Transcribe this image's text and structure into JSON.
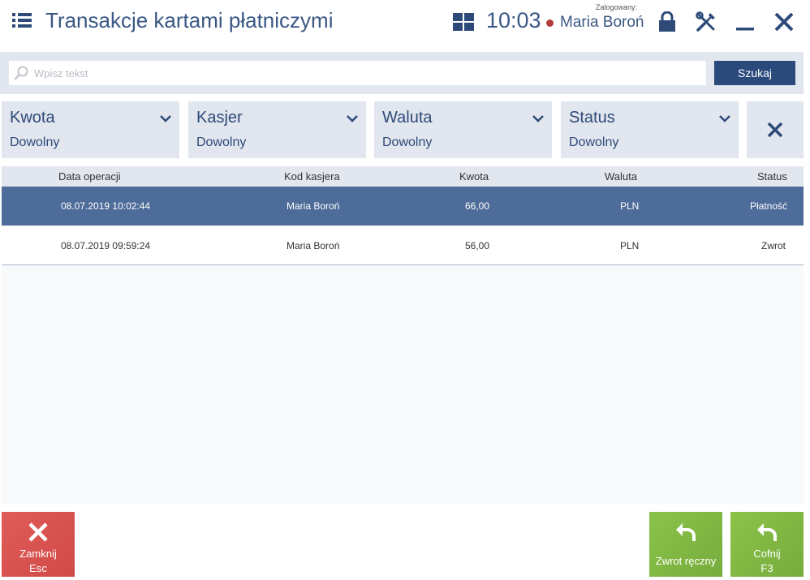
{
  "header": {
    "title": "Transakcje kartami płatniczymi",
    "clock": "10:03",
    "logged_label": "Zalogowany:",
    "user_name": "Maria Boroń",
    "status_color": "#b23b3b"
  },
  "search": {
    "placeholder": "Wpisz tekst",
    "value": "",
    "button_label": "Szukaj"
  },
  "filters": [
    {
      "label": "Kwota",
      "value": "Dowolny"
    },
    {
      "label": "Kasjer",
      "value": "Dowolny"
    },
    {
      "label": "Waluta",
      "value": "Dowolny"
    },
    {
      "label": "Status",
      "value": "Dowolny"
    }
  ],
  "table": {
    "columns": [
      "Data operacji",
      "Kod kasjera",
      "Kwota",
      "Waluta",
      "Status"
    ],
    "rows": [
      {
        "date": "08.07.2019 10:02:44",
        "cashier": "Maria Boroń",
        "amount": "66,00",
        "currency": "PLN",
        "status": "Płatność",
        "selected": true
      },
      {
        "date": "08.07.2019 09:59:24",
        "cashier": "Maria Boroń",
        "amount": "56,00",
        "currency": "PLN",
        "status": "Zwrot",
        "selected": false
      }
    ]
  },
  "buttons": {
    "close_label": "Zamknij",
    "close_key": "Esc",
    "manual_refund_label": "Zwrot ręczny",
    "undo_label": "Cofnij",
    "undo_key": "F3"
  },
  "colors": {
    "accent": "#3a5885",
    "selected_row": "#4e6c99",
    "search_button": "#2a4a7c",
    "close_button": "#d9534f",
    "green_button": "#8bc34a"
  }
}
